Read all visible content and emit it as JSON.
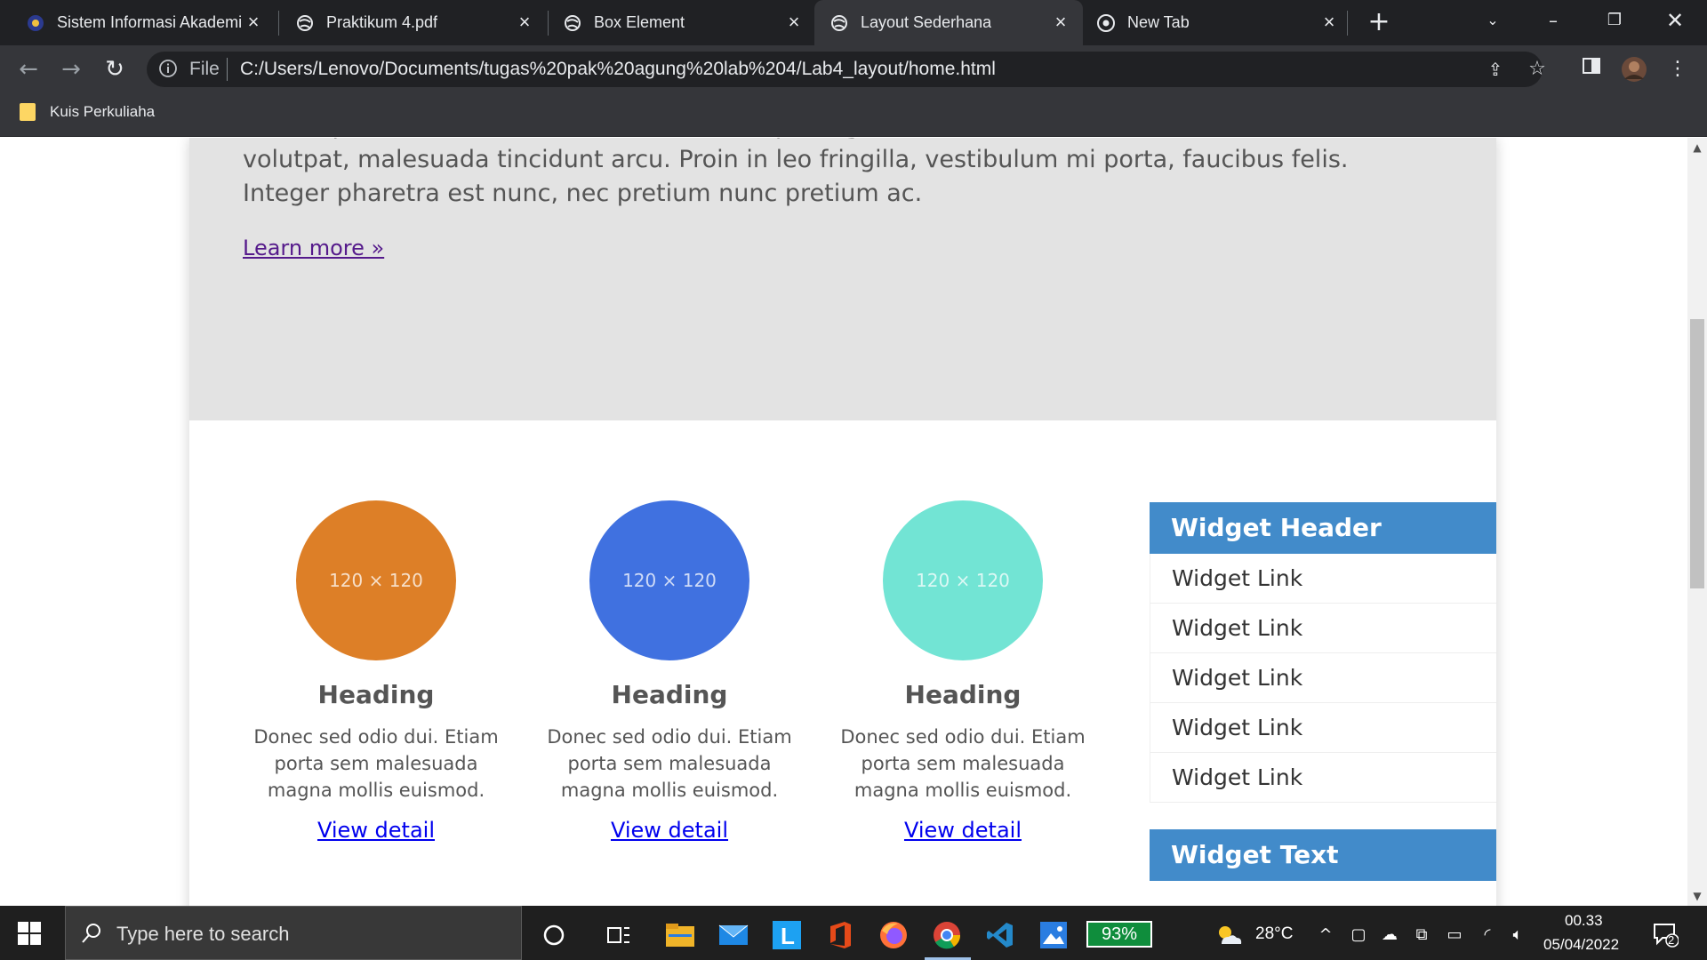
{
  "browser": {
    "tabs": [
      {
        "title": "Sistem Informasi Akademi",
        "active": false
      },
      {
        "title": "Praktikum 4.pdf",
        "active": false
      },
      {
        "title": "Box Element",
        "active": false
      },
      {
        "title": "Layout Sederhana",
        "active": true
      },
      {
        "title": "New Tab",
        "active": false
      }
    ],
    "file_label": "File",
    "url": "C:/Users/Lenovo/Documents/tugas%20pak%20agung%20lab%204/Lab4_layout/home.html",
    "bookmark": "Kuis Perkuliaha"
  },
  "page": {
    "jumbotron_text": "Lorem ipsum dolor sit amet, consectetur adipiscing elit. Vestibulum id elit, iaculis finibus volutpat, malesuada tincidunt arcu. Proin in leo fringilla, vestibulum mi porta, faucibus felis. Integer pharetra est nunc, nec pretium nunc pretium ac.",
    "learn_more": "Learn more »",
    "features": [
      {
        "image_label": "120 × 120",
        "color": "#dd7f27",
        "heading": "Heading",
        "text": "Donec sed odio dui. Etiam porta sem malesuada magna mollis euismod.",
        "link": "View detail"
      },
      {
        "image_label": "120 × 120",
        "color": "#4071e0",
        "heading": "Heading",
        "text": "Donec sed odio dui. Etiam porta sem malesuada magna mollis euismod.",
        "link": "View detail"
      },
      {
        "image_label": "120 × 120",
        "color": "#72e4d4",
        "heading": "Heading",
        "text": "Donec sed odio dui. Etiam porta sem malesuada magna mollis euismod.",
        "link": "View detail"
      }
    ],
    "widget_header": "Widget Header",
    "widget_links": [
      "Widget Link",
      "Widget Link",
      "Widget Link",
      "Widget Link",
      "Widget Link"
    ],
    "widget_text_header": "Widget Text"
  },
  "taskbar": {
    "search_placeholder": "Type here to search",
    "battery": "93%",
    "temperature": "28°C",
    "time": "00.33",
    "date": "05/04/2022",
    "notifications": "2"
  },
  "colors": {
    "widget_blue": "#428bca",
    "jumbotron_bg": "#e3e3e3"
  }
}
